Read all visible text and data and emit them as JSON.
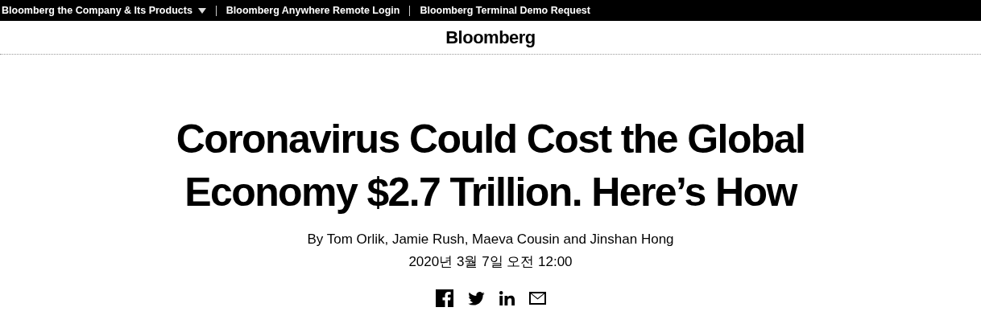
{
  "top_bar": {
    "links": [
      {
        "label": "Bloomberg the Company & Its Products",
        "has_menu": true
      },
      {
        "label": "Bloomberg Anywhere Remote Login",
        "has_menu": false
      },
      {
        "label": "Bloomberg Terminal Demo Request",
        "has_menu": false
      }
    ]
  },
  "masthead": {
    "logo": "Bloomberg"
  },
  "article": {
    "headline": "Coronavirus Could Cost the Global Economy $2.7 Trillion. Here’s How",
    "byline": "By Tom Orlik, Jamie Rush, Maeva Cousin and Jinshan Hong",
    "date": "2020년 3월 7일 오전 12:00",
    "share": [
      {
        "kind": "facebook"
      },
      {
        "kind": "twitter"
      },
      {
        "kind": "linkedin"
      },
      {
        "kind": "email"
      }
    ]
  }
}
